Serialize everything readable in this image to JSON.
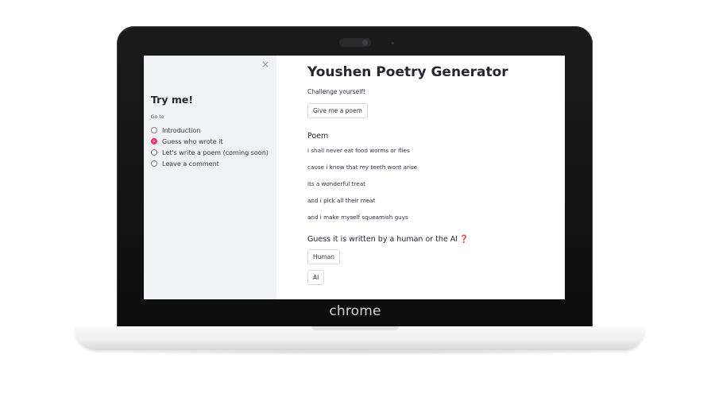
{
  "device": {
    "brand": "chrome"
  },
  "sidebar": {
    "close": "×",
    "title": "Try me!",
    "goto_label": "Go to",
    "options": [
      {
        "label": "Introduction",
        "selected": false
      },
      {
        "label": "Guess who wrote it",
        "selected": true
      },
      {
        "label": "Let's write a poem (coming soon)",
        "selected": false
      },
      {
        "label": "Leave a comment",
        "selected": false
      }
    ]
  },
  "main": {
    "title": "Youshen Poetry Generator",
    "subtitle": "Challenge yourself!",
    "generate_button": "Give me a poem",
    "poem_heading": "Poem",
    "poem_lines": [
      "i shall never eat food worms or flies",
      "cause i know that my teeth wont arise",
      "its a wonderful treat",
      "and i pick all their meat",
      "and i make myself squeamish guys"
    ],
    "guess_heading": "Guess it is written by a human or the AI",
    "guess_emoji": "❓",
    "human_button": "Human",
    "ai_button": "AI"
  },
  "colors": {
    "accent": "#f63366",
    "sidebar_bg": "#f0f2f6",
    "text": "#31333f"
  }
}
